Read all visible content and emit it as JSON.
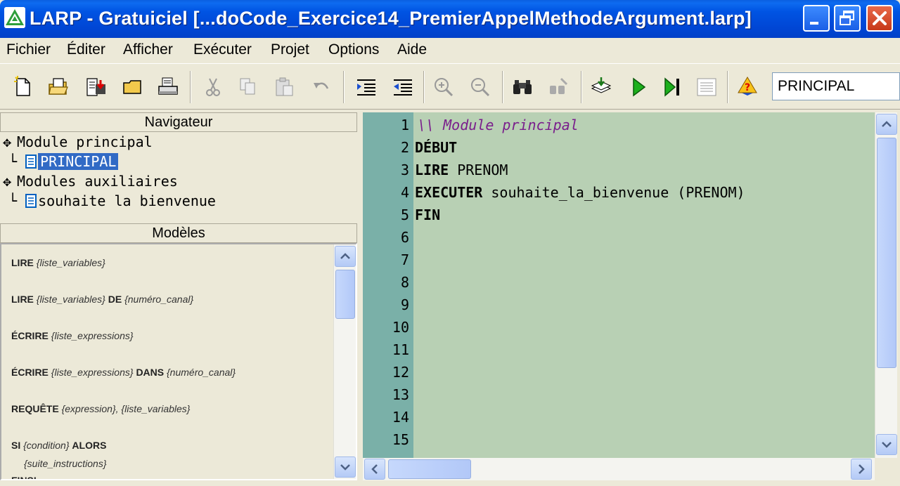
{
  "window": {
    "title": "LARP - Gratuiciel [...doCode_Exercice14_PremierAppelMethodeArgument.larp]"
  },
  "menu": {
    "items": [
      "Fichier",
      "Éditer",
      "Afficher",
      "Exécuter",
      "Projet",
      "Options",
      "Aide"
    ]
  },
  "toolbar": {
    "module_selector_value": "PRINCIPAL"
  },
  "navigator": {
    "header": "Navigateur",
    "main_group": "Module principal",
    "main_item": "PRINCIPAL",
    "aux_group": "Modules auxiliaires",
    "aux_item": "souhaite la bienvenue"
  },
  "models": {
    "header": "Modèles",
    "items": [
      {
        "kw": "LIRE",
        "arg": "{liste_variables}",
        "kw2": "",
        "arg2": ""
      },
      {
        "kw": "LIRE",
        "arg": "{liste_variables}",
        "kw2": "DE",
        "arg2": "{numéro_canal}"
      },
      {
        "kw": "ÉCRIRE",
        "arg": "{liste_expressions}",
        "kw2": "",
        "arg2": ""
      },
      {
        "kw": "ÉCRIRE",
        "arg": "{liste_expressions}",
        "kw2": "DANS",
        "arg2": "{numéro_canal}"
      },
      {
        "kw": "REQUÊTE",
        "arg": "{expression}, {liste_variables}",
        "kw2": "",
        "arg2": ""
      },
      {
        "kw": "SI",
        "arg": "{condition}",
        "kw2": "ALORS",
        "arg2": ""
      },
      {
        "kw": "",
        "arg": "{suite_instructions}",
        "kw2": "",
        "arg2": ""
      },
      {
        "kw": "FINSI",
        "arg": "",
        "kw2": "",
        "arg2": ""
      }
    ]
  },
  "editor": {
    "line_numbers": [
      "1",
      "2",
      "3",
      "4",
      "5",
      "6",
      "7",
      "8",
      "9",
      "10",
      "11",
      "12",
      "13",
      "14",
      "15"
    ],
    "lines": [
      {
        "kw": "",
        "rest": "",
        "comment": "\\\\ Module principal"
      },
      {
        "kw": "DÉBUT",
        "rest": "",
        "comment": ""
      },
      {
        "kw": "LIRE",
        "rest": " PRENOM",
        "comment": ""
      },
      {
        "kw": "EXECUTER",
        "rest": " souhaite_la_bienvenue (PRENOM)",
        "comment": ""
      },
      {
        "kw": "FIN",
        "rest": "",
        "comment": ""
      }
    ]
  }
}
